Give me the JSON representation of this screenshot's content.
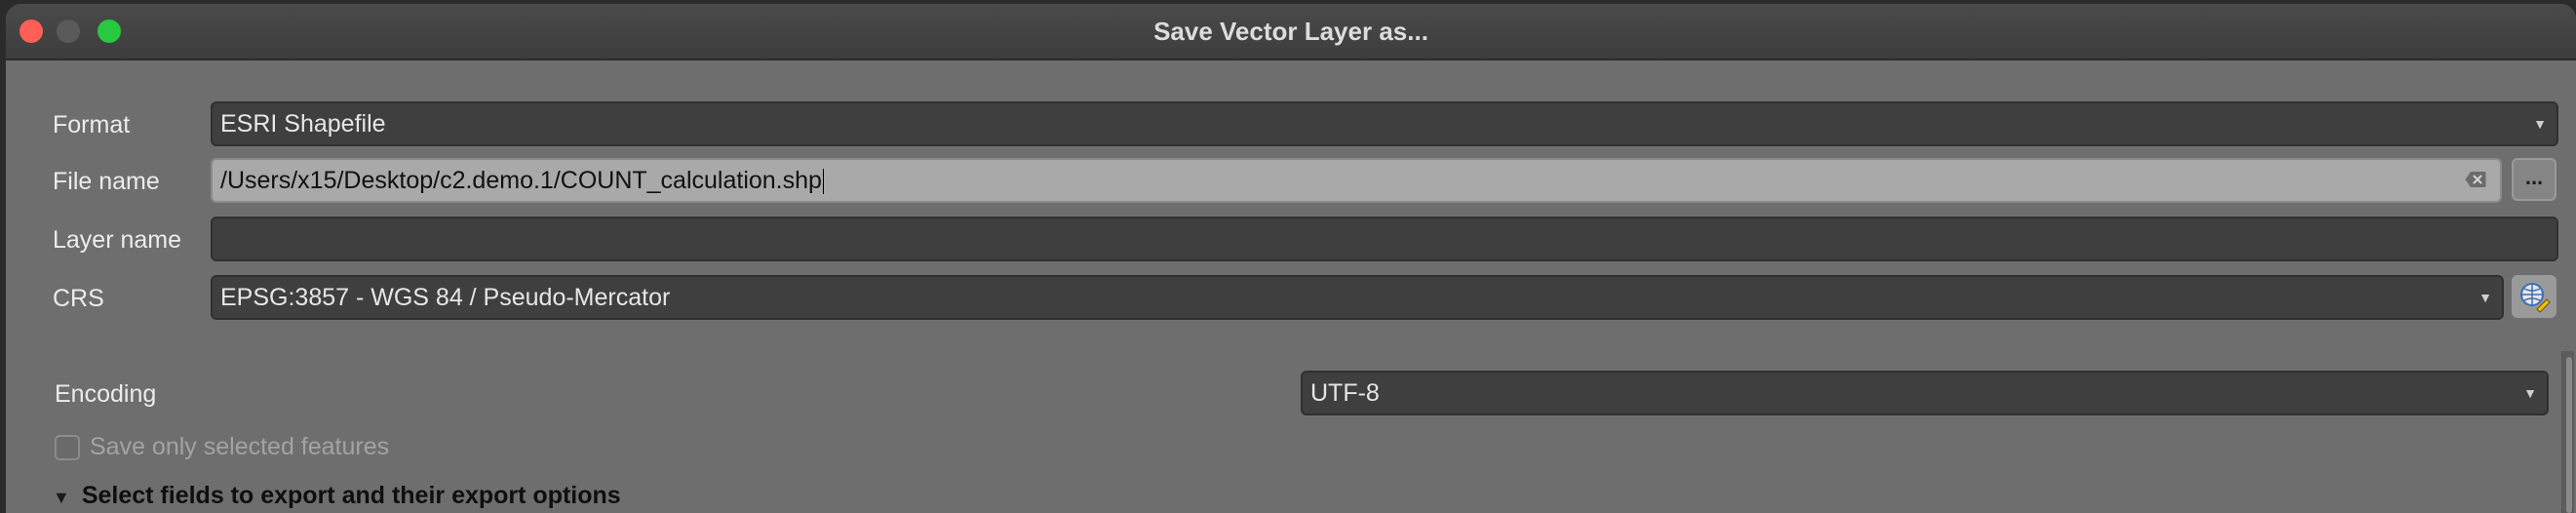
{
  "window": {
    "title": "Save Vector Layer as..."
  },
  "form": {
    "format_label": "Format",
    "format_value": "ESRI Shapefile",
    "filename_label": "File name",
    "filename_value": "/Users/x15/Desktop/c2.demo.1/COUNT_calculation.shp",
    "browse_label": "...",
    "layername_label": "Layer name",
    "layername_value": "",
    "crs_label": "CRS",
    "crs_value": "EPSG:3857 - WGS 84 / Pseudo-Mercator",
    "encoding_label": "Encoding",
    "encoding_value": "UTF-8",
    "selected_only_label": "Save only selected features",
    "selected_only_checked": false,
    "fields_section_label": "Select fields to export and their export options"
  },
  "icons": {
    "dropdown": "chevron-down-icon",
    "clear": "clear-text-icon",
    "crs_selector": "globe-pencil-icon",
    "section_toggle": "triangle-down-icon"
  },
  "colors": {
    "close": "#ff5f57",
    "minimize": "#5a5a5a",
    "maximize": "#28c840",
    "dialog_bg": "#6e6e6e",
    "field_bg": "#3f3f3f",
    "active_field_bg": "#a9a9a9"
  }
}
